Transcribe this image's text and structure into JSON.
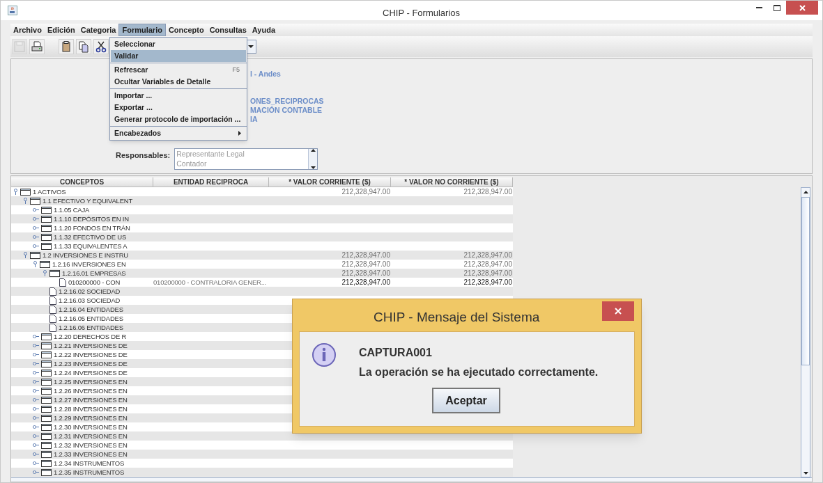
{
  "window": {
    "title": "CHIP - Formularios"
  },
  "menu_bar": [
    {
      "label": "Archivo",
      "selected": false
    },
    {
      "label": "Edición",
      "selected": false
    },
    {
      "label": "Categoria",
      "selected": false
    },
    {
      "label": "Formulario",
      "selected": true
    },
    {
      "label": "Concepto",
      "selected": false
    },
    {
      "label": "Consultas",
      "selected": false
    },
    {
      "label": "Ayuda",
      "selected": false
    }
  ],
  "toolbar": [
    {
      "kind": "save",
      "disabled": true
    },
    {
      "kind": "print",
      "disabled": false
    },
    {
      "kind": "gap"
    },
    {
      "kind": "paste",
      "disabled": false
    },
    {
      "kind": "copy",
      "disabled": false
    },
    {
      "kind": "cut",
      "disabled": false
    }
  ],
  "open_menu": {
    "groups": [
      [
        {
          "label": "Seleccionar",
          "selected": false
        },
        {
          "label": "Validar",
          "selected": true
        }
      ],
      [
        {
          "label": "Refrescar",
          "shortcut": "F5",
          "selected": false
        },
        {
          "label": "Ocultar Variables de Detalle",
          "selected": false
        }
      ],
      [
        {
          "label": "Importar ...",
          "selected": false
        },
        {
          "label": "Exportar ...",
          "selected": false
        },
        {
          "label": "Generar protocolo de importación ...",
          "selected": false
        }
      ],
      [
        {
          "label": "Encabezados",
          "submenu": true,
          "selected": false
        }
      ]
    ]
  },
  "header": {
    "groups": [
      [
        "l - Andes"
      ],
      [
        "ONES_RECIPROCAS",
        "MACIÓN CONTABLE",
        "IA"
      ]
    ],
    "responsables": {
      "label": "Responsables:",
      "items": [
        "Representante Legal",
        "Contador"
      ]
    }
  },
  "table": {
    "columns": [
      "CONCEPTOS",
      "ENTIDAD RECIPROCA",
      "* VALOR CORRIENTE ($)",
      "* VALOR NO CORRIENTE ($)"
    ],
    "rows": [
      {
        "kind": "folder",
        "label": "1 ACTIVOS",
        "expanded": true,
        "corriente": "212,328,947.00",
        "no_corriente": "212,328,947.00",
        "calculated": true,
        "children": [
          {
            "kind": "folder",
            "label": "1.1 EFECTIVO Y EQUIVALENT",
            "expanded": true,
            "children": [
              {
                "kind": "folder",
                "label": "1.1.05 CAJA",
                "expanded": false
              },
              {
                "kind": "folder",
                "label": "1.1.10 DEPÓSITOS EN IN",
                "expanded": false
              },
              {
                "kind": "folder",
                "label": "1.1.20 FONDOS EN TRÁN",
                "expanded": false
              },
              {
                "kind": "folder",
                "label": "1.1.32 EFECTIVO DE US",
                "expanded": false
              },
              {
                "kind": "folder",
                "label": "1.1.33 EQUIVALENTES A",
                "expanded": false
              }
            ]
          },
          {
            "kind": "folder",
            "label": "1.2 INVERSIONES E INSTRU",
            "expanded": true,
            "corriente": "212,328,947.00",
            "no_corriente": "212,328,947.00",
            "calculated": true,
            "children": [
              {
                "kind": "folder",
                "label": "1.2.16 INVERSIONES EN",
                "expanded": true,
                "corriente": "212,328,947.00",
                "no_corriente": "212,328,947.00",
                "calculated": true,
                "children": [
                  {
                    "kind": "folder",
                    "label": "1.2.16.01 EMPRESAS",
                    "expanded": true,
                    "corriente": "212,328,947.00",
                    "no_corriente": "212,328,947.00",
                    "calculated": true,
                    "children": [
                      {
                        "kind": "document",
                        "label": "010200000 - CON",
                        "entidad": "010200000 - CONTRALORIA GENER...",
                        "corriente": "212,328,947.00",
                        "no_corriente": "212,328,947.00",
                        "calculated": false
                      }
                    ]
                  },
                  {
                    "kind": "document",
                    "label": "1.2.16.02 SOCIEDAD"
                  },
                  {
                    "kind": "document",
                    "label": "1.2.16.03 SOCIEDAD"
                  },
                  {
                    "kind": "document",
                    "label": "1.2.16.04 ENTIDADES"
                  },
                  {
                    "kind": "document",
                    "label": "1.2.16.05 ENTIDADES"
                  },
                  {
                    "kind": "document",
                    "label": "1.2.16.06 ENTIDADES"
                  }
                ]
              },
              {
                "kind": "folder",
                "label": "1.2.20 DERECHOS DE R",
                "expanded": false
              },
              {
                "kind": "folder",
                "label": "1.2.21 INVERSIONES DE",
                "expanded": false
              },
              {
                "kind": "folder",
                "label": "1.2.22 INVERSIONES DE",
                "expanded": false
              },
              {
                "kind": "folder",
                "label": "1.2.23 INVERSIONES DE",
                "expanded": false
              },
              {
                "kind": "folder",
                "label": "1.2.24 INVERSIONES DE",
                "expanded": false
              },
              {
                "kind": "folder",
                "label": "1.2.25 INVERSIONES EN",
                "expanded": false
              },
              {
                "kind": "folder",
                "label": "1.2.26 INVERSIONES EN",
                "expanded": false
              },
              {
                "kind": "folder",
                "label": "1.2.27 INVERSIONES EN",
                "expanded": false
              },
              {
                "kind": "folder",
                "label": "1.2.28 INVERSIONES EN",
                "expanded": false
              },
              {
                "kind": "folder",
                "label": "1.2.29 INVERSIONES EN",
                "expanded": false
              },
              {
                "kind": "folder",
                "label": "1.2.30 INVERSIONES EN",
                "expanded": false
              },
              {
                "kind": "folder",
                "label": "1.2.31 INVERSIONES EN",
                "expanded": false
              },
              {
                "kind": "folder",
                "label": "1.2.32 INVERSIONES EN",
                "expanded": false
              },
              {
                "kind": "folder",
                "label": "1.2.33 INVERSIONES EN",
                "expanded": false
              },
              {
                "kind": "folder",
                "label": "1.2.34 INSTRUMENTOS",
                "expanded": false
              },
              {
                "kind": "folder",
                "label": "1.2.35 INSTRUMENTOS",
                "expanded": false
              }
            ]
          }
        ]
      }
    ]
  },
  "dialog": {
    "title": "CHIP - Mensaje del Sistema",
    "code": "CAPTURA001",
    "message": "La operación se ha ejecutado correctamente.",
    "button": "Aceptar"
  }
}
